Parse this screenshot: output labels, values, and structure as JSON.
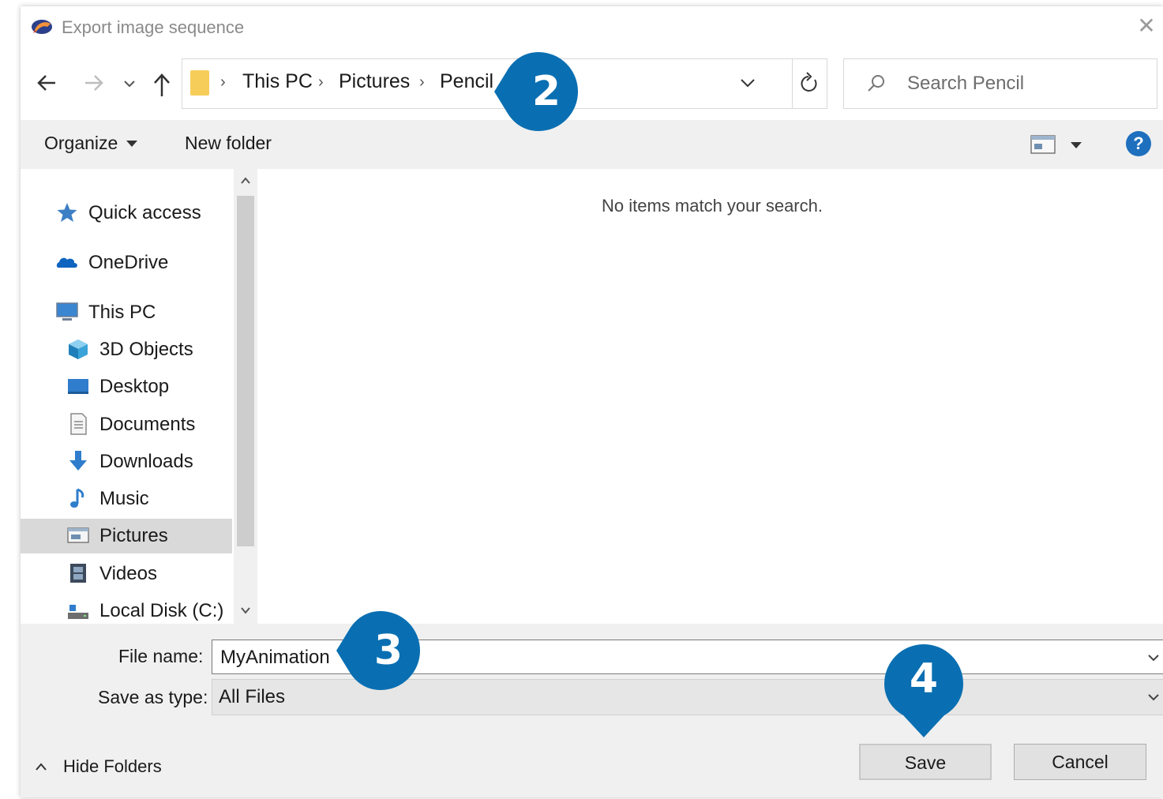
{
  "window": {
    "title": "Export image sequence",
    "close_glyph": "✕"
  },
  "nav": {
    "back_icon": "arrow-left-icon",
    "forward_icon": "arrow-right-icon",
    "recent_icon": "chevron-down-icon",
    "up_icon": "arrow-up-icon"
  },
  "address": {
    "breadcrumbs": [
      "This PC",
      "Pictures",
      "Pencil"
    ],
    "separator": "›"
  },
  "search": {
    "placeholder": "Search Pencil"
  },
  "toolbar": {
    "organize_label": "Organize",
    "new_folder_label": "New folder",
    "help_glyph": "?"
  },
  "sidebar": {
    "items": [
      {
        "label": "Quick access",
        "icon": "star-icon"
      },
      {
        "label": "OneDrive",
        "icon": "cloud-icon"
      },
      {
        "label": "This PC",
        "icon": "computer-icon"
      },
      {
        "label": "3D Objects",
        "icon": "cube-icon"
      },
      {
        "label": "Desktop",
        "icon": "desktop-icon"
      },
      {
        "label": "Documents",
        "icon": "document-icon"
      },
      {
        "label": "Downloads",
        "icon": "download-icon"
      },
      {
        "label": "Music",
        "icon": "music-note-icon"
      },
      {
        "label": "Pictures",
        "icon": "pictures-icon",
        "selected": true
      },
      {
        "label": "Videos",
        "icon": "film-icon"
      },
      {
        "label": "Local Disk (C:)",
        "icon": "drive-icon"
      }
    ]
  },
  "content": {
    "empty_message": "No items match your search."
  },
  "form": {
    "file_name_label": "File name:",
    "file_name_value": "MyAnimation",
    "save_type_label": "Save as type:",
    "save_type_value": "All Files"
  },
  "footer": {
    "hide_folders_label": "Hide Folders",
    "save_label": "Save",
    "cancel_label": "Cancel"
  },
  "callouts": {
    "step2": "2",
    "step3": "3",
    "step4": "4"
  },
  "colors": {
    "callout_blue": "#0a6fb2",
    "folder_yellow": "#f7cd5a",
    "help_blue": "#1e6fbe"
  }
}
